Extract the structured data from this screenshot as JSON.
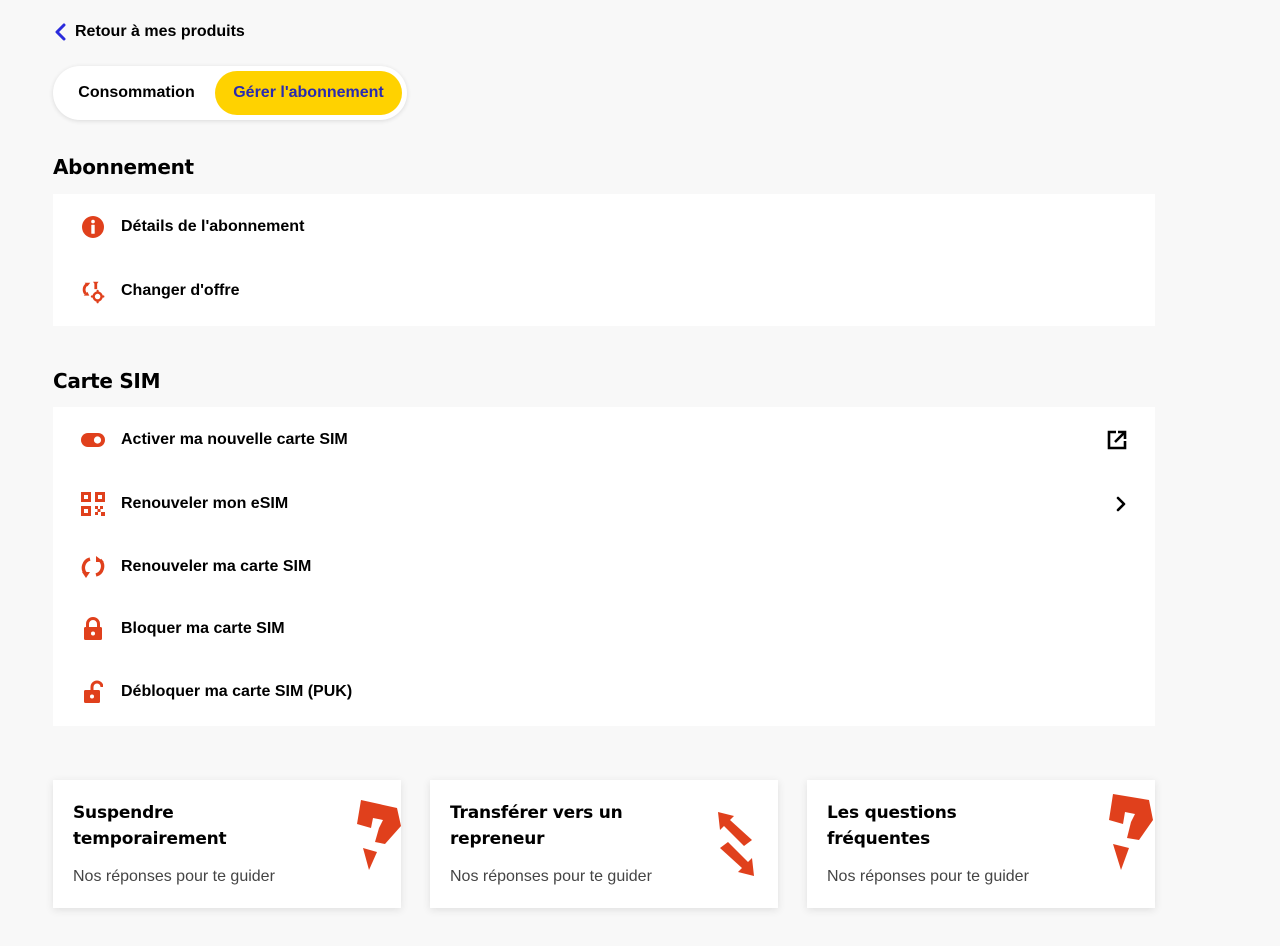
{
  "nav": {
    "back_label": "Retour à mes produits"
  },
  "tabs": [
    {
      "label": "Consommation",
      "active": false
    },
    {
      "label": "Gérer l'abonnement",
      "active": true
    }
  ],
  "subscription": {
    "title": "Abonnement",
    "items": [
      {
        "label": "Détails de l'abonnement",
        "icon": "info-icon"
      },
      {
        "label": "Changer d'offre",
        "icon": "change-offer-icon"
      }
    ]
  },
  "sim": {
    "title": "Carte SIM",
    "items": [
      {
        "label": "Activer ma nouvelle carte SIM",
        "icon": "toggle-icon",
        "trail": "external-link-icon"
      },
      {
        "label": "Renouveler mon eSIM",
        "icon": "qr-code-icon",
        "trail": "chevron-right-icon"
      },
      {
        "label": "Renouveler ma carte SIM",
        "icon": "refresh-icon"
      },
      {
        "label": "Bloquer ma carte SIM",
        "icon": "lock-icon"
      },
      {
        "label": "Débloquer ma carte SIM (PUK)",
        "icon": "unlock-icon"
      }
    ]
  },
  "tiles": [
    {
      "title": "Suspendre temporairement",
      "subtitle": "Nos réponses pour te guider",
      "art": "question-mark-art"
    },
    {
      "title": "Transférer vers un repreneur",
      "subtitle": "Nos réponses pour te guider",
      "art": "transfer-arrows-art"
    },
    {
      "title": "Les questions fréquentes",
      "subtitle": "Nos réponses pour te guider",
      "art": "question-mark-art"
    }
  ],
  "colors": {
    "accent": "#e0401c",
    "tab_active_bg": "#ffd200",
    "tab_active_text": "#2a2bb0",
    "back_chevron": "#2a2bdc",
    "page_bg": "#f8f8f8"
  }
}
